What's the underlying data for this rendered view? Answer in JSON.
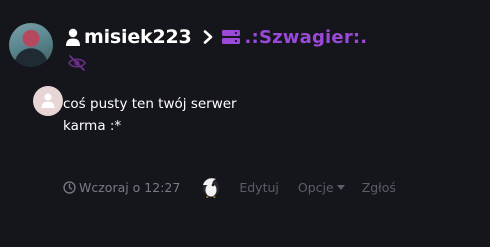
{
  "post": {
    "author": {
      "name": "misiek223",
      "icon": "user-icon"
    },
    "breadcrumb_separator_icon": "chevron-right-icon",
    "server": {
      "name": ".:Szwagier:.",
      "icon": "server-icon",
      "color": "#9b49d8"
    },
    "visibility_icon": "eye-slash-icon",
    "reply_avatar_icon": "user-icon",
    "content": {
      "line1": "coś pusty ten twój serwer",
      "line2": "karma :*"
    },
    "footer": {
      "time_icon": "clock-icon",
      "timestamp": "Wczoraj o 12:27",
      "reaction_icon": "penguin-reaction-icon",
      "edit_label": "Edytuj",
      "options_label": "Opcje",
      "report_label": "Zgłoś"
    }
  },
  "colors": {
    "background": "#15151c",
    "accent": "#9b49d8",
    "muted_text": "#7a7a86",
    "action_text": "#5e5e6a"
  }
}
